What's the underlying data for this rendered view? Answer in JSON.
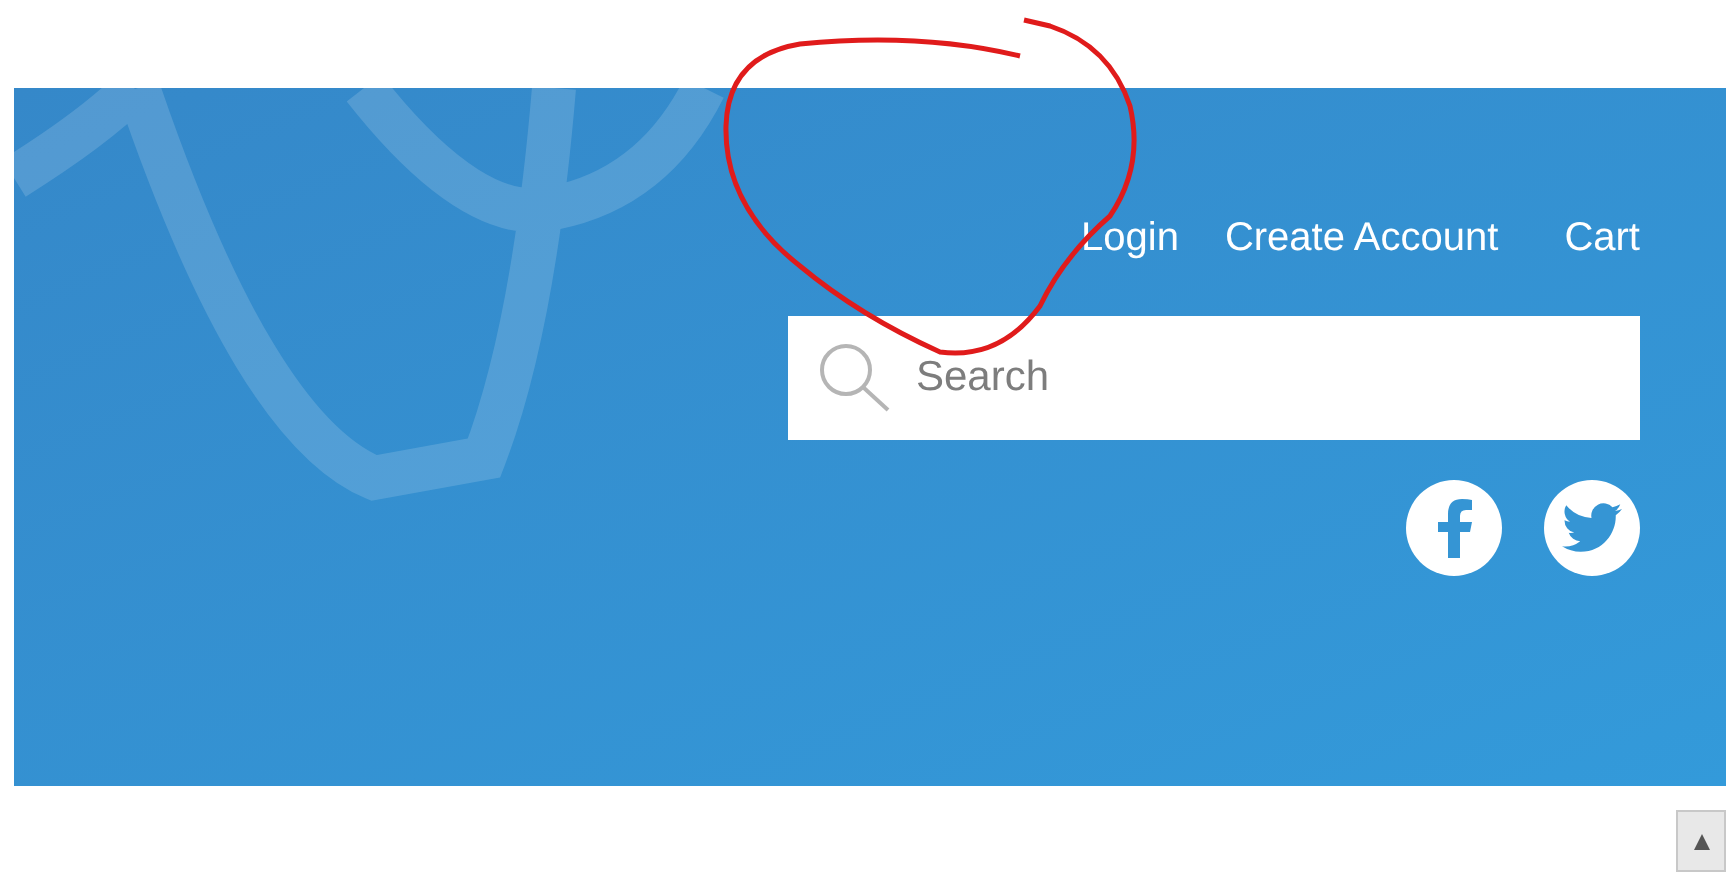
{
  "nav": {
    "links": [
      "Login",
      "Create Account",
      "Cart"
    ]
  },
  "search": {
    "placeholder": "Search"
  }
}
